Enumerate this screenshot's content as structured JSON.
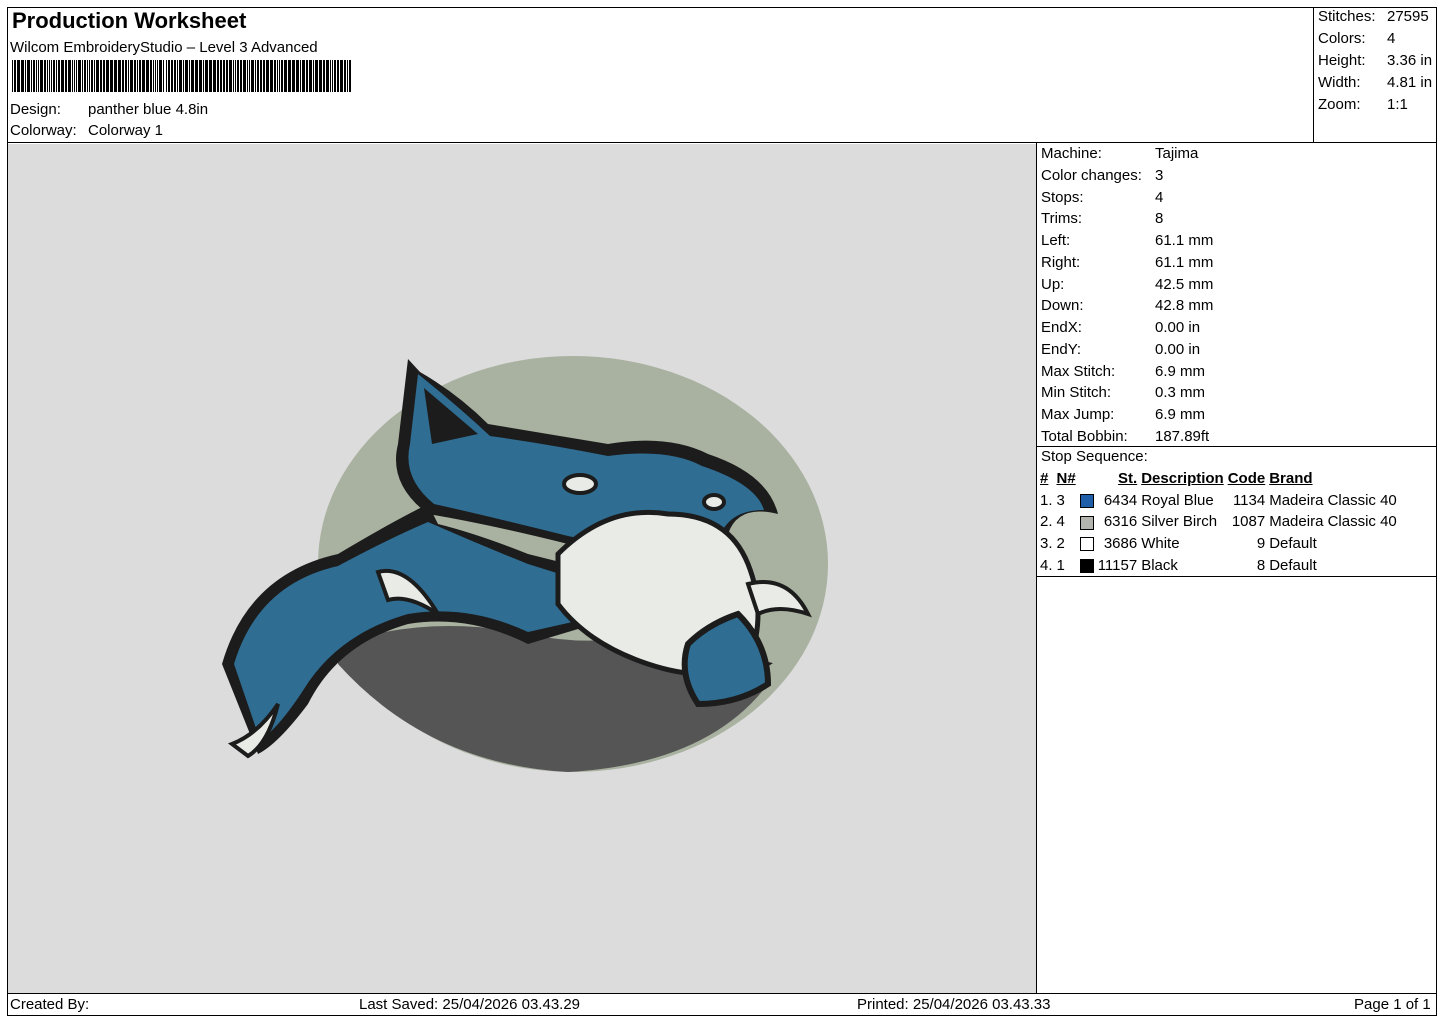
{
  "header": {
    "title": "Production Worksheet",
    "software": "Wilcom EmbroideryStudio – Level 3 Advanced",
    "design_label": "Design:",
    "design_value": "panther blue 4.8in",
    "colorway_label": "Colorway:",
    "colorway_value": "Colorway 1"
  },
  "summary": [
    {
      "label": "Stitches:",
      "value": "27595"
    },
    {
      "label": "Colors:",
      "value": "4"
    },
    {
      "label": "Height:",
      "value": "3.36 in"
    },
    {
      "label": "Width:",
      "value": "4.81 in"
    },
    {
      "label": "Zoom:",
      "value": "1:1"
    }
  ],
  "machine_info": [
    {
      "label": "Machine:",
      "value": "Tajima"
    },
    {
      "label": "Color changes:",
      "value": "3"
    },
    {
      "label": "Stops:",
      "value": "4"
    },
    {
      "label": "Trims:",
      "value": "8"
    },
    {
      "label": "Left:",
      "value": "61.1 mm"
    },
    {
      "label": "Right:",
      "value": "61.1 mm"
    },
    {
      "label": "Up:",
      "value": "42.5 mm"
    },
    {
      "label": "Down:",
      "value": "42.8 mm"
    },
    {
      "label": "EndX:",
      "value": "0.00 in"
    },
    {
      "label": "EndY:",
      "value": "0.00 in"
    },
    {
      "label": "Max Stitch:",
      "value": "6.9 mm"
    },
    {
      "label": "Min Stitch:",
      "value": "0.3 mm"
    },
    {
      "label": "Max Jump:",
      "value": "6.9 mm"
    },
    {
      "label": "Total Bobbin:",
      "value": "187.89ft"
    }
  ],
  "stop_sequence": {
    "heading": "Stop Sequence:",
    "columns": [
      "#",
      "N#",
      "St.",
      "Description",
      "Code",
      "Brand"
    ],
    "rows": [
      {
        "index": "1.",
        "n": "3",
        "color": "#1f5ea8",
        "st": "6434",
        "description": "Royal Blue",
        "code": "1134",
        "brand": "Madeira Classic 40"
      },
      {
        "index": "2.",
        "n": "4",
        "color": "#b4b4ae",
        "st": "6316",
        "description": "Silver Birch",
        "code": "1087",
        "brand": "Madeira Classic 40"
      },
      {
        "index": "3.",
        "n": "2",
        "color": "#ffffff",
        "st": "3686",
        "description": "White",
        "code": "9",
        "brand": "Default"
      },
      {
        "index": "4.",
        "n": "1",
        "color": "#000000",
        "st": "11157",
        "description": "Black",
        "code": "8",
        "brand": "Default"
      }
    ]
  },
  "footer": {
    "created_by": "Created By:",
    "last_saved": "Last Saved: 25/04/2026 03.43.29",
    "printed": "Printed: 25/04/2026 03.43.33",
    "page": "Page 1 of 1"
  },
  "design_colors": {
    "background": "#dcdcdc",
    "circle": "#a9b2a0",
    "blue": "#2f6d92",
    "black": "#1c1c1c",
    "white": "#e9ece6",
    "dark_fill": "#555555"
  }
}
